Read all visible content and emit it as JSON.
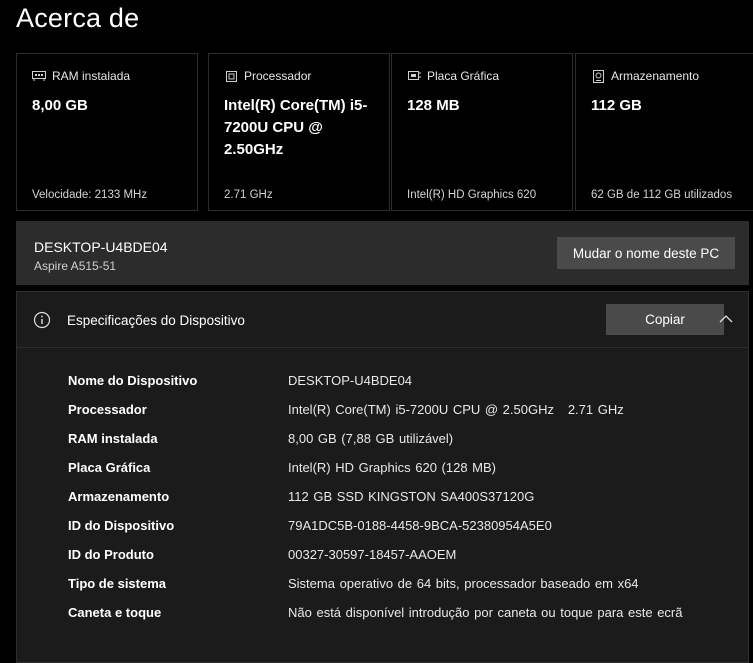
{
  "page": {
    "title": "Acerca de"
  },
  "cards": [
    {
      "icon": "ram-icon",
      "label": "RAM instalada",
      "value": "8,00 GB",
      "sub": "Velocidade: 2133 MHz"
    },
    {
      "icon": "cpu-icon",
      "label": "Processador",
      "value": "Intel(R) Core(TM) i5-7200U CPU @ 2.50GHz",
      "sub": "2.71 GHz"
    },
    {
      "icon": "gpu-icon",
      "label": "Placa Gráfica",
      "value": "128 MB",
      "sub": "Intel(R) HD Graphics 620"
    },
    {
      "icon": "storage-icon",
      "label": "Armazenamento",
      "value": "112 GB",
      "sub": "62 GB de 112 GB utilizados"
    }
  ],
  "pc": {
    "name": "DESKTOP-U4BDE04",
    "model": "Aspire A515-51",
    "rename_label": "Mudar o nome deste PC"
  },
  "specs": {
    "title": "Especificações do Dispositivo",
    "copy_label": "Copiar",
    "rows": [
      {
        "key": "Nome do Dispositivo",
        "value": "DESKTOP-U4BDE04"
      },
      {
        "key": "Processador",
        "value": "Intel(R) Core(TM) i5-7200U CPU @ 2.50GHz   2.71 GHz"
      },
      {
        "key": "RAM instalada",
        "value": "8,00 GB (7,88 GB utilizável)"
      },
      {
        "key": "Placa Gráfica",
        "value": "Intel(R) HD Graphics 620 (128 MB)"
      },
      {
        "key": "Armazenamento",
        "value": "112 GB SSD KINGSTON SA400S37120G"
      },
      {
        "key": "ID do Dispositivo",
        "value": "79A1DC5B-0188-4458-9BCA-52380954A5E0"
      },
      {
        "key": "ID do Produto",
        "value": "00327-30597-18457-AAOEM"
      },
      {
        "key": "Tipo de sistema",
        "value": "Sistema operativo de 64 bits, processador baseado em x64"
      },
      {
        "key": "Caneta e toque",
        "value": "Não está disponível introdução por caneta ou toque para este ecrã"
      }
    ]
  }
}
